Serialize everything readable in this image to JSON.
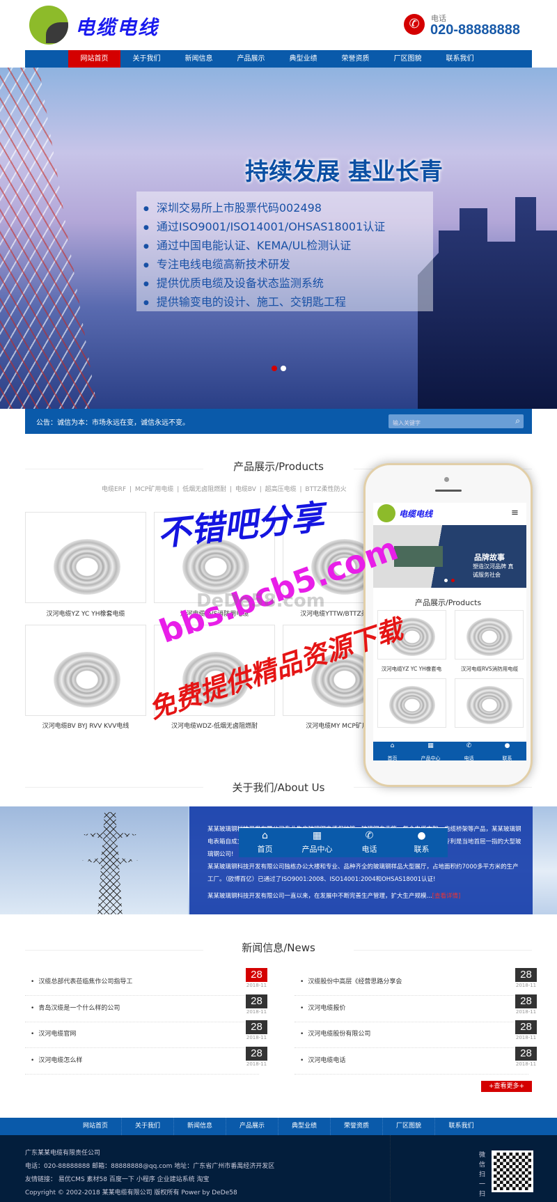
{
  "header": {
    "logo_text": "电缆电线",
    "phone_label": "电话",
    "phone_number": "020-88888888",
    "phone_icon": "phone-icon"
  },
  "nav": {
    "items": [
      "网站首页",
      "关于我们",
      "新闻信息",
      "产品展示",
      "典型业绩",
      "荣誉资质",
      "厂区图貌",
      "联系我们"
    ],
    "active_index": 0
  },
  "banner": {
    "title": "持续发展 基业长青",
    "bullets": [
      "深圳交易所上市股票代码002498",
      "通过ISO9001/ISO14001/OHSAS18001认证",
      "通过中国电能认证、KEMA/UL检测认证",
      "专注电线电缆高新技术研发",
      "提供优质电缆及设备状态监测系统",
      "提供输变电的设计、施工、交钥匙工程"
    ],
    "slides": 2,
    "active_slide": 0
  },
  "notice": {
    "text": "公告：诚信为本：市场永远在变，诚信永远不变。",
    "search_placeholder": "输入关键字"
  },
  "products": {
    "title": "产品展示/Products",
    "categories": "电缆ERF  |  MCP矿用电缆  |  低烟无卤阻燃耐  |  电缆BV  |  超高压电缆  |  BTTZ柔性防火",
    "items": [
      "汉河电缆YZ YC YH橡套电缆",
      "汉河电缆RVS消防用电缆",
      "汉河电缆YTTW/BTTZ柔性防火",
      "汉河电缆BV BYJ RVV KVV电线",
      "汉河电缆WDZ-低烟无卤阻燃耐",
      "汉河电缆MY MCP矿用电缆"
    ]
  },
  "about": {
    "title": "关于我们/About Us",
    "paragraphs": [
      "某某玻璃钢科技开发有限公司专业生产玻璃钢电缆保护管、玻璃钢电表箱、复合电缆支架、电缆桥架等产品，某某玻璃钢电表箱自成立以来我公司（玻璃钢集团）就取得了良好的优异成绩，单下来多个玻璃钢制品专利是当地首屈一指的大型玻璃钢公司!",
      "某某玻璃钢科技开发有限公司独栋办公大楼和专业、品种齐全的玻璃钢样品大型展厅，占地面积约7000多平方米的生产工厂。（欧博百亿）已通过了ISO9001:2008、ISO14001:2004和OHSAS18001认证!",
      "某某玻璃钢科技开发有限公司一直以来，在发展中不断完善生产管理，扩大生产规模..."
    ],
    "more": "[查看详情]"
  },
  "mobile_nav": [
    {
      "label": "首页",
      "icon": "home-icon"
    },
    {
      "label": "产品中心",
      "icon": "grid-icon"
    },
    {
      "label": "电话",
      "icon": "phone-icon"
    },
    {
      "label": "联系",
      "icon": "user-icon"
    }
  ],
  "news": {
    "title": "新闻信息/News",
    "left": [
      {
        "title": "汉缆总部代表莅临焦作公司指导工",
        "day": "28",
        "ym": "2018-11"
      },
      {
        "title": "青岛汉缆是一个什么样的公司",
        "day": "28",
        "ym": "2018-11"
      },
      {
        "title": "汉河电缆官网",
        "day": "28",
        "ym": "2018-11"
      },
      {
        "title": "汉河电缆怎么样",
        "day": "28",
        "ym": "2018-11"
      }
    ],
    "right": [
      {
        "title": "汉缆股份中高层《经营思路分享会",
        "day": "28",
        "ym": "2018-11"
      },
      {
        "title": "汉河电缆报价",
        "day": "28",
        "ym": "2018-11"
      },
      {
        "title": "汉河电缆股份有限公司",
        "day": "28",
        "ym": "2018-11"
      },
      {
        "title": "汉河电缆电话",
        "day": "28",
        "ym": "2018-11"
      }
    ],
    "more": "+查看更多+"
  },
  "footer": {
    "nav": [
      "网站首页",
      "关于我们",
      "新闻信息",
      "产品展示",
      "典型业绩",
      "荣誉资质",
      "厂区图貌",
      "联系我们"
    ],
    "company": "广东某某电缆有限责任公司",
    "contact": "电话：020-88888888  邮箱：88888888@qq.com  地址：广东省广州市番禺经济开发区",
    "links_label": "友情链接：",
    "links": [
      "易优CMS",
      "素材58",
      "百度一下",
      "小程序",
      "企业建站系统",
      "淘宝"
    ],
    "copyright": "Copyright © 2002-2018 某某电缆有限公司 版权所有 Power by DeDe58",
    "qr_label": "微信扫一扫"
  },
  "phone_mockup": {
    "logo_text": "电缆电线",
    "banner_title": "品牌故事",
    "banner_sub": "塑造汉河品牌 真诚服务社会",
    "products_title": "产品展示/Products",
    "items": [
      "汉河电缆YZ YC YH橡套电",
      "汉河电缆RVS消防用电缆"
    ]
  },
  "watermarks": [
    "不错吧分享",
    "bbs.bcb5.com",
    "免费提供精品资源下载",
    "DeDe58.com"
  ],
  "colors": {
    "brand_blue": "#0a5aaa",
    "accent_red": "#d40000",
    "footer_dark": "#031e3c"
  }
}
